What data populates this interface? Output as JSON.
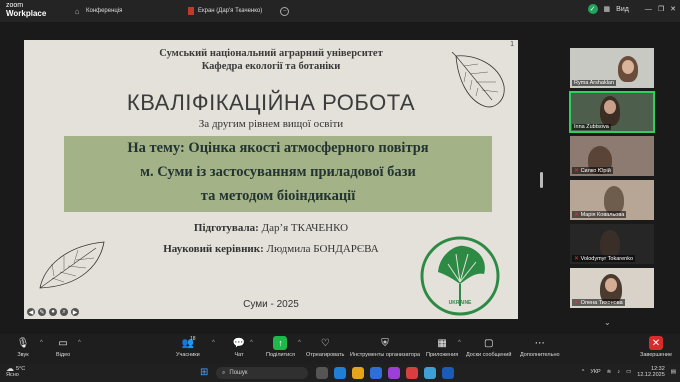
{
  "app": {
    "brand_line1": "zoom",
    "brand_line2": "Workplace"
  },
  "tabs": [
    {
      "label": "Конференція"
    },
    {
      "label": "Екран (Дар'я Ткаченко)"
    }
  ],
  "window": {
    "view_label": "Вид"
  },
  "slide": {
    "page_number": "1",
    "university": "Сумський національний аграрний університет",
    "department": "Кафедра екології та ботаніки",
    "title": "КВАЛІФІКАЦІЙНА РОБОТА",
    "level": "За другим рівнем вищої освіти",
    "topic_line1": "На тему: Оцінка якості атмосферного повітря",
    "topic_line2": "м. Суми із застосуванням приладової бази",
    "topic_line3": "та методом біоіндикації",
    "author_label": "Підготувала:",
    "author_name": "Дар’я ТКАЧЕНКО",
    "advisor_label": "Науковий керівник:",
    "advisor_name": "Людмила БОНДАРЄВА",
    "city_year": "Суми - 2025",
    "logo_text": "UKRAINE"
  },
  "participants": [
    {
      "name": "Ryma Arshaklan",
      "muted": false,
      "active": false
    },
    {
      "name": "Inna Zubtsova",
      "muted": false,
      "active": true
    },
    {
      "name": "Силко Юрій",
      "muted": true,
      "active": false
    },
    {
      "name": "Марія Ковальова",
      "muted": true,
      "active": false
    },
    {
      "name": "Volodymyr Tokarenko",
      "muted": true,
      "active": false
    },
    {
      "name": "Олена Тихонова",
      "muted": true,
      "active": false
    }
  ],
  "toolbar": {
    "audio": "Звук",
    "video": "Відео",
    "participants": "Учасники",
    "participants_count": "18",
    "chat": "Чат",
    "share": "Поділитися",
    "react": "Отреагировать",
    "host_tools": "Инструменты организатора",
    "apps": "Приложения",
    "whiteboards": "Доски сообщений",
    "more": "Дополнительно",
    "end": "Завершение"
  },
  "taskbar": {
    "temperature": "5°C",
    "weather": "Ясно",
    "search_placeholder": "Пошук",
    "language": "УКР",
    "time": "12:32",
    "date": "12.12.2025"
  },
  "colors": {
    "accent_green": "#2fd05e",
    "topic_box": "#a4b387",
    "end_red": "#d82b2b"
  }
}
